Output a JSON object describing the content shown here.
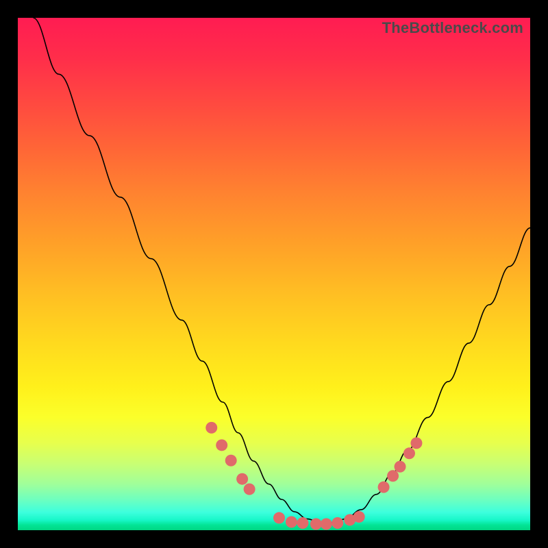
{
  "watermark": "TheBottleneck.com",
  "colors": {
    "dot": "#e06a6a",
    "curve": "#000000",
    "frame": "#000000"
  },
  "chart_data": {
    "type": "line",
    "title": "",
    "xlabel": "",
    "ylabel": "",
    "xlim": [
      0,
      100
    ],
    "ylim": [
      0,
      100
    ],
    "grid": false,
    "legend": false,
    "note": "Values are percent of plot width/height; y measured from top (0) to bottom (100). Curve is a V-shaped bottleneck profile with flat minimum; dots mark sampled points on the curve near and at the trough.",
    "series": [
      {
        "name": "curve",
        "kind": "line",
        "x": [
          3,
          8,
          14,
          20,
          26,
          32,
          36,
          40,
          43,
          46,
          49,
          51.5,
          54,
          56.5,
          59,
          61.5,
          64,
          67,
          70,
          73,
          76,
          80,
          84,
          88,
          92,
          96,
          100
        ],
        "y": [
          0,
          11,
          23,
          35,
          47,
          59,
          67,
          75,
          81,
          86.5,
          91,
          94,
          96.4,
          97.8,
          98.5,
          98.5,
          97.8,
          96,
          93,
          89,
          84.5,
          78,
          71,
          63.5,
          56,
          48.5,
          41
        ]
      },
      {
        "name": "left-shoulder-dots",
        "kind": "scatter",
        "x": [
          37.8,
          39.8,
          41.6,
          43.8,
          45.2
        ],
        "y": [
          80.0,
          83.4,
          86.4,
          90.0,
          92.0
        ]
      },
      {
        "name": "trough-dots",
        "kind": "scatter",
        "x": [
          51.0,
          53.4,
          55.6,
          58.2,
          60.2,
          62.4,
          64.8,
          66.6
        ],
        "y": [
          97.6,
          98.4,
          98.6,
          98.8,
          98.8,
          98.6,
          98.0,
          97.4
        ]
      },
      {
        "name": "right-shoulder-dots",
        "kind": "scatter",
        "x": [
          71.4,
          73.2,
          74.6,
          76.4,
          77.8
        ],
        "y": [
          91.6,
          89.4,
          87.6,
          85.0,
          83.0
        ]
      }
    ]
  }
}
